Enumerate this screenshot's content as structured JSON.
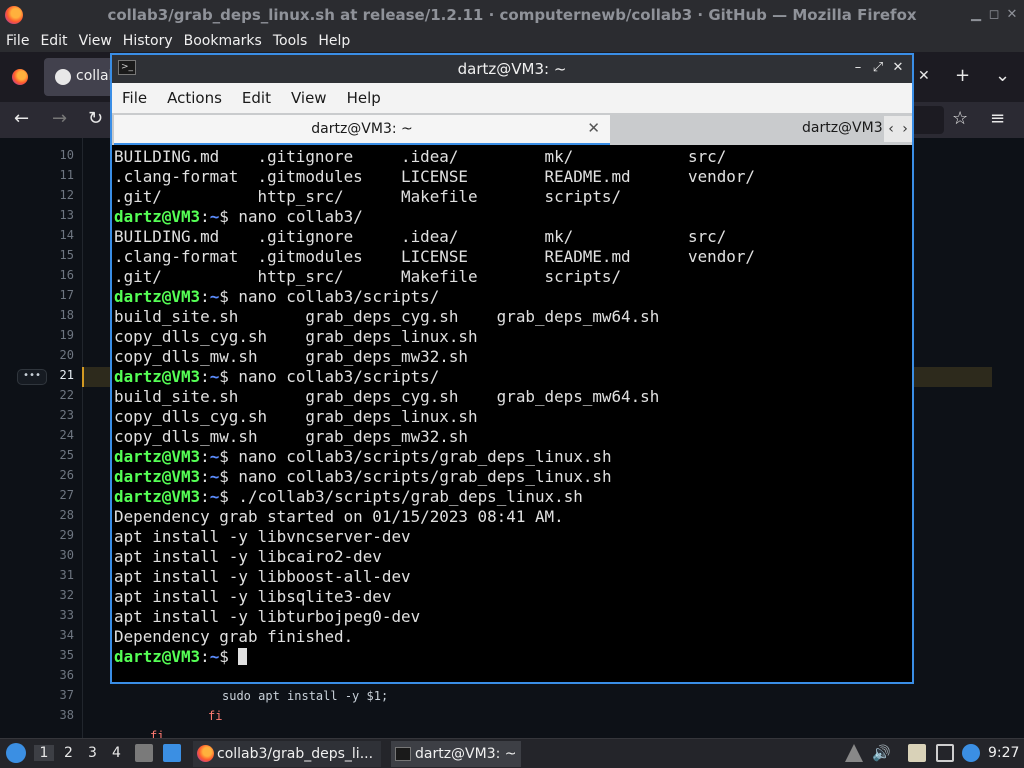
{
  "firefox": {
    "window_title": "collab3/grab_deps_linux.sh at release/1.2.11 · computernewb/collab3 · GitHub — Mozilla Firefox",
    "menu": [
      "File",
      "Edit",
      "View",
      "History",
      "Bookmarks",
      "Tools",
      "Help"
    ],
    "tab_label": "collab",
    "icons": {
      "back": "←",
      "forward": "→",
      "reload": "↻",
      "star": "☆",
      "menu": "≡",
      "new_tab": "+",
      "tab_list": "⌄",
      "tab_close": "✕"
    }
  },
  "code": {
    "line_numbers": [
      "10",
      "11",
      "12",
      "13",
      "14",
      "15",
      "16",
      "17",
      "18",
      "19",
      "20",
      "21",
      "22",
      "23",
      "24",
      "25",
      "26",
      "27",
      "28",
      "29",
      "30",
      "31",
      "32",
      "33",
      "34",
      "35",
      "36",
      "37",
      "38"
    ],
    "line_37": "sudo apt install -y $1;",
    "line_38": "fi",
    "line_39_partial": "fi",
    "highlighted_line": "21"
  },
  "terminal": {
    "title": "dartz@VM3: ~",
    "menu": [
      "File",
      "Actions",
      "Edit",
      "View",
      "Help"
    ],
    "tabs": [
      {
        "label": "dartz@VM3: ~",
        "active": true
      },
      {
        "label": "dartz@VM3",
        "active": false
      }
    ],
    "prompt": {
      "user": "dartz@VM3",
      "sep": ":",
      "path": "~",
      "sym": "$"
    },
    "lines": [
      {
        "type": "out",
        "text": "BUILDING.md    .gitignore     .idea/         mk/            src/"
      },
      {
        "type": "out",
        "text": ".clang-format  .gitmodules    LICENSE        README.md      vendor/"
      },
      {
        "type": "out",
        "text": ".git/          http_src/      Makefile       scripts/"
      },
      {
        "type": "cmd",
        "text": " nano collab3/"
      },
      {
        "type": "out",
        "text": "BUILDING.md    .gitignore     .idea/         mk/            src/"
      },
      {
        "type": "out",
        "text": ".clang-format  .gitmodules    LICENSE        README.md      vendor/"
      },
      {
        "type": "out",
        "text": ".git/          http_src/      Makefile       scripts/"
      },
      {
        "type": "cmd",
        "text": " nano collab3/scripts/"
      },
      {
        "type": "out",
        "text": "build_site.sh       grab_deps_cyg.sh    grab_deps_mw64.sh"
      },
      {
        "type": "out",
        "text": "copy_dlls_cyg.sh    grab_deps_linux.sh"
      },
      {
        "type": "out",
        "text": "copy_dlls_mw.sh     grab_deps_mw32.sh"
      },
      {
        "type": "cmd",
        "text": " nano collab3/scripts/"
      },
      {
        "type": "out",
        "text": "build_site.sh       grab_deps_cyg.sh    grab_deps_mw64.sh"
      },
      {
        "type": "out",
        "text": "copy_dlls_cyg.sh    grab_deps_linux.sh"
      },
      {
        "type": "out",
        "text": "copy_dlls_mw.sh     grab_deps_mw32.sh"
      },
      {
        "type": "cmd",
        "text": " nano collab3/scripts/grab_deps_linux.sh"
      },
      {
        "type": "cmd",
        "text": " nano collab3/scripts/grab_deps_linux.sh"
      },
      {
        "type": "cmd",
        "text": " ./collab3/scripts/grab_deps_linux.sh"
      },
      {
        "type": "out",
        "text": "Dependency grab started on 01/15/2023 08:41 AM."
      },
      {
        "type": "out",
        "text": "apt install -y libvncserver-dev"
      },
      {
        "type": "out",
        "text": "apt install -y libcairo2-dev"
      },
      {
        "type": "out",
        "text": "apt install -y libboost-all-dev"
      },
      {
        "type": "out",
        "text": "apt install -y libsqlite3-dev"
      },
      {
        "type": "out",
        "text": "apt install -y libturbojpeg0-dev"
      },
      {
        "type": "out",
        "text": "Dependency grab finished."
      },
      {
        "type": "cmd",
        "text": " "
      }
    ]
  },
  "taskbar": {
    "workspaces": [
      "1",
      "2",
      "3",
      "4"
    ],
    "tasks": [
      {
        "label": "collab3/grab_deps_li..."
      },
      {
        "label": "dartz@VM3: ~"
      }
    ],
    "clock": "9:27"
  }
}
